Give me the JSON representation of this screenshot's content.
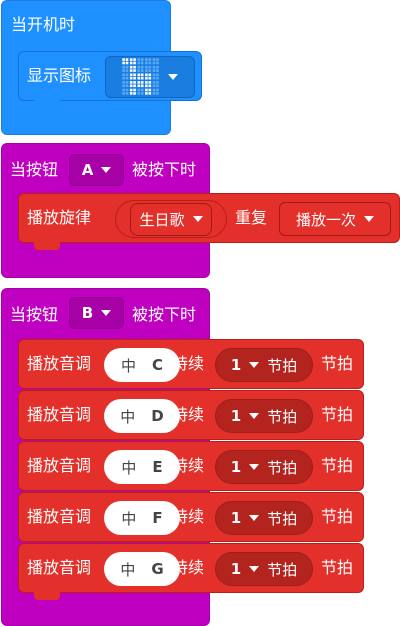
{
  "block1": {
    "hat_label": "当开机时",
    "show_icon_label": "显示图标",
    "icon_name": "giraffe-icon"
  },
  "block2": {
    "hat_prefix": "当按钮",
    "button_value": "A",
    "hat_suffix": "被按下时",
    "melody_label": "播放旋律",
    "melody_value": "生日歌",
    "repeat_label": "重复",
    "repeat_value": "播放一次"
  },
  "block3": {
    "hat_prefix": "当按钮",
    "button_value": "B",
    "hat_suffix": "被按下时",
    "notes": [
      {
        "label": "播放音调",
        "pitch_zh": "中",
        "pitch_letter": "C",
        "duration_label": "持续",
        "beats": "1",
        "beat_unit": "节拍",
        "suffix": "节拍"
      },
      {
        "label": "播放音调",
        "pitch_zh": "中",
        "pitch_letter": "D",
        "duration_label": "持续",
        "beats": "1",
        "beat_unit": "节拍",
        "suffix": "节拍"
      },
      {
        "label": "播放音调",
        "pitch_zh": "中",
        "pitch_letter": "E",
        "duration_label": "持续",
        "beats": "1",
        "beat_unit": "节拍",
        "suffix": "节拍"
      },
      {
        "label": "播放音调",
        "pitch_zh": "中",
        "pitch_letter": "F",
        "duration_label": "持续",
        "beats": "1",
        "beat_unit": "节拍",
        "suffix": "节拍"
      },
      {
        "label": "播放音调",
        "pitch_zh": "中",
        "pitch_letter": "G",
        "duration_label": "持续",
        "beats": "1",
        "beat_unit": "节拍",
        "suffix": "节拍"
      }
    ]
  },
  "colors": {
    "basic_blue": "#1e90ff",
    "input_magenta": "#c000c0",
    "music_red": "#e3302a"
  }
}
